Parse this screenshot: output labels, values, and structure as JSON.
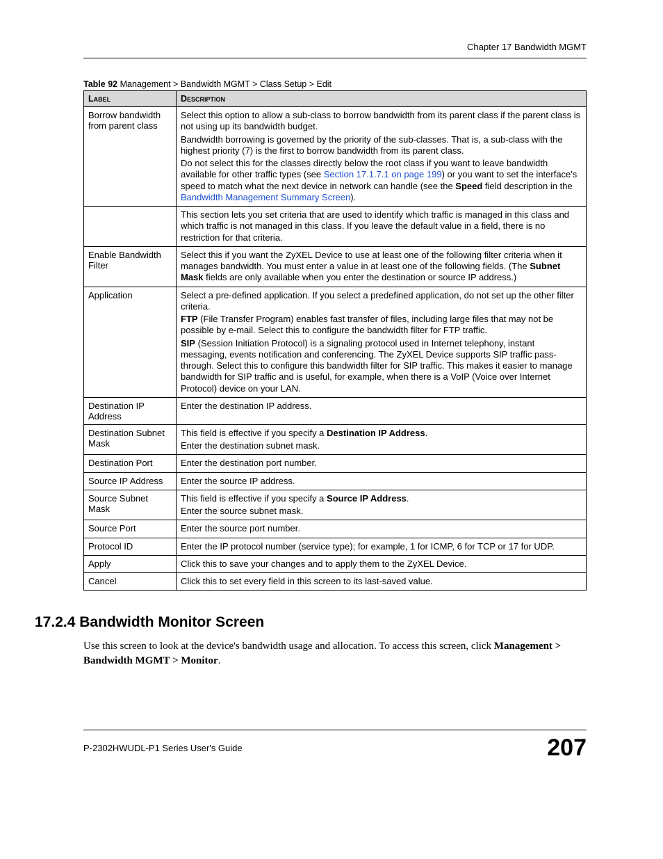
{
  "header": {
    "chapter": "Chapter 17 Bandwidth MGMT"
  },
  "table_caption": {
    "label": "Table 92",
    "text": "   Management > Bandwidth MGMT > Class Setup > Edit"
  },
  "table": {
    "head": {
      "col1": "Label",
      "col2": "Description"
    },
    "rows": [
      {
        "label": "Borrow bandwidth from parent class",
        "desc": {
          "p1": "Select this option to allow a sub-class to borrow bandwidth from its parent class if the parent class is not using up its bandwidth budget.",
          "p2": "Bandwidth borrowing is governed by the priority of the sub-classes. That is, a sub-class with the highest priority (7) is the first to borrow bandwidth from its parent class.",
          "p3a": "Do not select this for the classes directly below the root class if you want to leave bandwidth available for other traffic types (see ",
          "link1": "Section 17.1.7.1 on page 199",
          "p3b": ") or you want to set the interface's speed to match what the next device in network can handle (see the ",
          "bold1": "Speed",
          "p3c": " field description in the ",
          "link2": "Bandwidth Management Summary Screen",
          "p3d": ")."
        }
      },
      {
        "label": "",
        "desc": {
          "p1": "This section lets you set criteria that are used to identify which traffic is managed in this class and which traffic is not managed in this class. If you leave the default value in a field, there is no restriction for that criteria."
        }
      },
      {
        "label": "Enable Bandwidth Filter",
        "desc": {
          "p1a": "Select this if you want the ZyXEL Device to use at least one of the following filter criteria when it manages bandwidth. You must enter a value in at least one of the following fields. (The ",
          "bold1": "Subnet Mask",
          "p1b": " fields are only available when you enter the destination or source IP address.)"
        }
      },
      {
        "label": "Application",
        "desc": {
          "p1": "Select a pre-defined application. If you select a predefined application, do not set up the other filter criteria.",
          "p2bold": "FTP",
          "p2": " (File Transfer Program) enables fast transfer of files, including large files that may not be possible by e-mail. Select this to configure the bandwidth filter for FTP traffic.",
          "p3bold": "SIP",
          "p3": " (Session Initiation Protocol) is a signaling protocol used in Internet telephony, instant messaging, events notification and conferencing. The ZyXEL Device supports SIP traffic pass-through. Select this to configure this bandwidth filter for SIP traffic. This makes it easier to manage bandwidth for SIP traffic and is useful, for example, when there is a VoIP (Voice over Internet Protocol) device on your LAN."
        }
      },
      {
        "label": "Destination IP Address",
        "desc": {
          "p1": "Enter the destination IP address."
        }
      },
      {
        "label": "Destination Subnet Mask",
        "desc": {
          "p1a": "This field is effective if you specify a ",
          "bold1": "Destination IP Address",
          "p1b": ".",
          "p2": "Enter the destination subnet mask."
        }
      },
      {
        "label": "Destination Port",
        "desc": {
          "p1": "Enter the destination port number."
        }
      },
      {
        "label": "Source IP Address",
        "desc": {
          "p1": "Enter the source IP address."
        }
      },
      {
        "label": "Source Subnet Mask",
        "desc": {
          "p1a": "This field is effective if you specify a ",
          "bold1": "Source IP Address",
          "p1b": ".",
          "p2": "Enter the source subnet mask."
        }
      },
      {
        "label": "Source Port",
        "desc": {
          "p1": "Enter the source port number."
        }
      },
      {
        "label": "Protocol ID",
        "desc": {
          "p1": "Enter the IP protocol number (service type); for example, 1 for ICMP, 6 for TCP or 17 for UDP."
        }
      },
      {
        "label": "Apply",
        "desc": {
          "p1": "Click this to save your changes and to apply them to the ZyXEL Device."
        }
      },
      {
        "label": "Cancel",
        "desc": {
          "p1": "Click this to set every field in this screen to its last-saved value."
        }
      }
    ]
  },
  "section": {
    "heading": "17.2.4  Bandwidth Monitor Screen",
    "body": {
      "p1a": "Use this screen to look at the device's bandwidth usage and allocation. To access this screen, click ",
      "bold1": "Management > Bandwidth MGMT > Monitor",
      "p1b": "."
    }
  },
  "footer": {
    "guide": "P-2302HWUDL-P1 Series User's Guide",
    "page": "207"
  }
}
